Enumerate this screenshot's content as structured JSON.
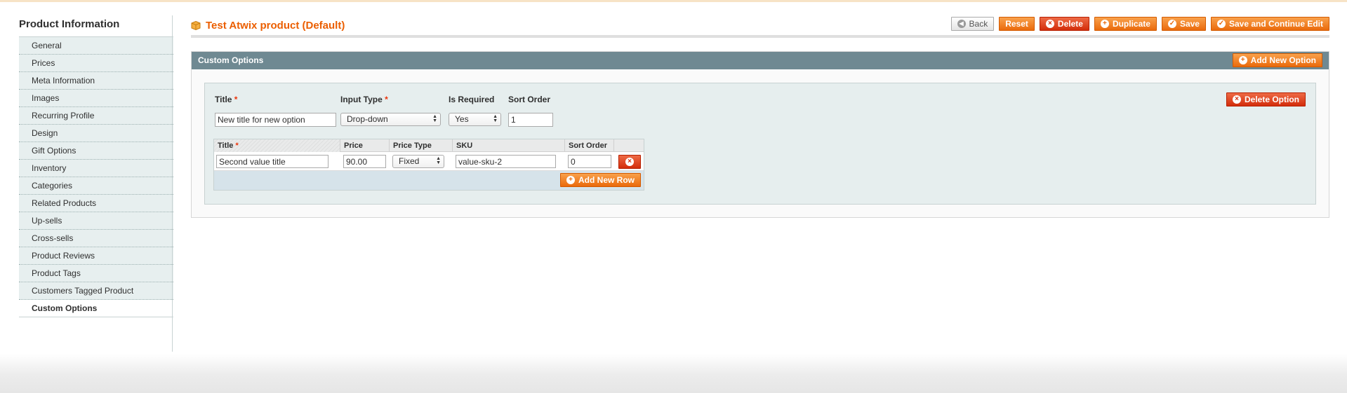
{
  "sidebar": {
    "title": "Product Information",
    "items": [
      {
        "label": "General"
      },
      {
        "label": "Prices"
      },
      {
        "label": "Meta Information"
      },
      {
        "label": "Images"
      },
      {
        "label": "Recurring Profile"
      },
      {
        "label": "Design"
      },
      {
        "label": "Gift Options"
      },
      {
        "label": "Inventory"
      },
      {
        "label": "Categories"
      },
      {
        "label": "Related Products"
      },
      {
        "label": "Up-sells"
      },
      {
        "label": "Cross-sells"
      },
      {
        "label": "Product Reviews"
      },
      {
        "label": "Product Tags"
      },
      {
        "label": "Customers Tagged Product"
      },
      {
        "label": "Custom Options",
        "active": true
      }
    ]
  },
  "header": {
    "title": "Test Atwix product (Default)",
    "icon": "box-icon",
    "buttons": {
      "back": "Back",
      "reset": "Reset",
      "delete": "Delete",
      "duplicate": "Duplicate",
      "save": "Save",
      "save_continue": "Save and Continue Edit"
    }
  },
  "custom_options": {
    "title": "Custom Options",
    "add_new_option": "Add New Option",
    "delete_option": "Delete Option",
    "labels": {
      "title": "Title",
      "input_type": "Input Type",
      "is_required": "Is Required",
      "sort_order": "Sort Order",
      "required_mark": "*"
    },
    "option": {
      "title_value": "New title for new option",
      "input_type": "Drop-down",
      "is_required": "Yes",
      "sort_order": "1"
    },
    "grid": {
      "headers": {
        "title": "Title",
        "price": "Price",
        "price_type": "Price Type",
        "sku": "SKU",
        "sort_order": "Sort Order"
      },
      "row": {
        "title": "Second value title",
        "price": "90.00",
        "price_type": "Fixed",
        "sku": "value-sku-2",
        "sort_order": "0"
      },
      "add_new_row": "Add New Row"
    }
  },
  "colors": {
    "accent": "#eb5e00",
    "panel_header": "#6f8992",
    "delete_red": "#d32d0b"
  }
}
